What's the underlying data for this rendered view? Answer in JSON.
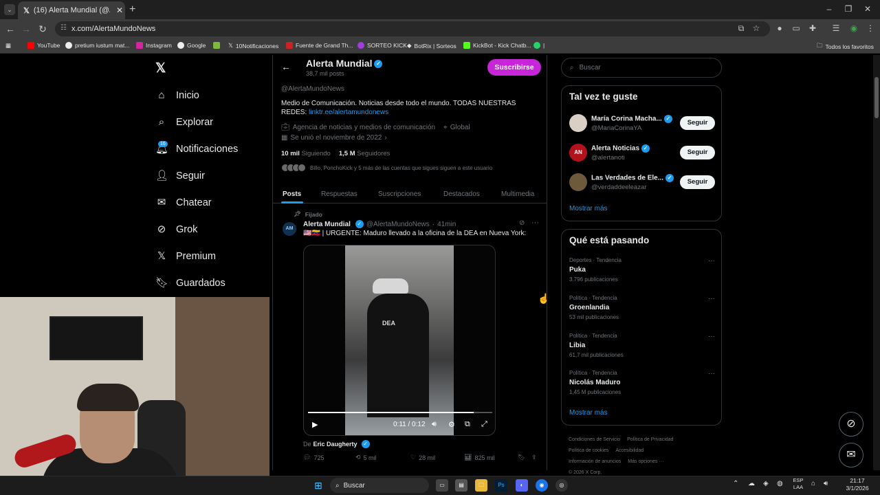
{
  "browser": {
    "tab_title": "(16) Alerta Mundial (@AlertaM",
    "url": "x.com/AlertaMundoNews",
    "bookmarks": [
      "YouTube",
      "pretium iustum mat...",
      "Instagram",
      "Google",
      "",
      "10Notificaciones",
      "Fuente de Grand Th...",
      "SORTEO KICK",
      "BotRix | Sorteos",
      "KickBot - Kick Chatb...",
      ""
    ],
    "all_bookmarks": "Todos los favoritos"
  },
  "nav": {
    "items": [
      "Inicio",
      "Explorar",
      "Notificaciones",
      "Seguir",
      "Chatear",
      "Grok",
      "Premium",
      "Guardados"
    ],
    "notif_count": "16"
  },
  "profile": {
    "name": "Alerta Mundial",
    "posts_count": "38,7 mil posts",
    "subscribe": "Suscribirse",
    "handle": "@AlertaMundoNews",
    "bio": "Medio de Comunicación. Noticias desde todo el mundo. TODAS NUESTRAS REDES: ",
    "bio_link": "linktr.ee/alertamundonews",
    "category": "Agencia de noticias y medios de comunicación",
    "location": "Global",
    "joined": "Se unió el noviembre de 2022",
    "following_num": "10 mil",
    "following_label": "Siguiendo",
    "followers_num": "1,5 M",
    "followers_label": "Seguidores",
    "followed_by": "Billo, PonchoKick y 5 más de las cuentas que sigues siguen a este usuario",
    "tabs": [
      "Posts",
      "Respuestas",
      "Suscripciones",
      "Destacados",
      "Multimedia"
    ]
  },
  "tweet": {
    "pinned": "Fijado",
    "author": "Alerta Mundial",
    "handle": "@AlertaMundoNews",
    "time": "41min",
    "text": "🇺🇸🇻🇪 | URGENTE: Maduro llevado a la oficina de la DEA en Nueva York:",
    "video_time": "0:11 / 0:12",
    "video_progress": 0.9,
    "from_label": "De",
    "from_author": "Eric Daugherty",
    "replies": "725",
    "reposts": "5 mil",
    "likes": "28 mil",
    "views": "825 mil"
  },
  "sidebar": {
    "search_placeholder": "Buscar",
    "suggest_title": "Tal vez te guste",
    "suggestions": [
      {
        "name": "María Corina Macha...",
        "handle": "@MariaCorinaYA"
      },
      {
        "name": "Alerta Noticias",
        "handle": "@alertanoti"
      },
      {
        "name": "Las Verdades de Ele...",
        "handle": "@verdaddeeleazar"
      }
    ],
    "follow_label": "Seguir",
    "show_more": "Mostrar más",
    "trends_title": "Qué está pasando",
    "trends": [
      {
        "category": "Deportes · Tendencia",
        "name": "Puka",
        "count": "3.796 publicaciones"
      },
      {
        "category": "Política · Tendencia",
        "name": "Groenlandia",
        "count": "53 mil publicaciones"
      },
      {
        "category": "Política · Tendencia",
        "name": "Libia",
        "count": "61,7 mil publicaciones"
      },
      {
        "category": "Política · Tendencia",
        "name": "Nicolás Maduro",
        "count": "1,45 M publicaciones"
      }
    ],
    "footer": [
      "Condiciones de Servicio",
      "Política de Privacidad",
      "Política de cookies",
      "Accesibilidad",
      "Información de anuncios",
      "Más opciones ···",
      "© 2026 X Corp."
    ]
  },
  "taskbar": {
    "search": "Buscar",
    "lang_top": "ESP",
    "lang_bottom": "LAA",
    "time": "21:17",
    "date": "3/1/2026"
  }
}
